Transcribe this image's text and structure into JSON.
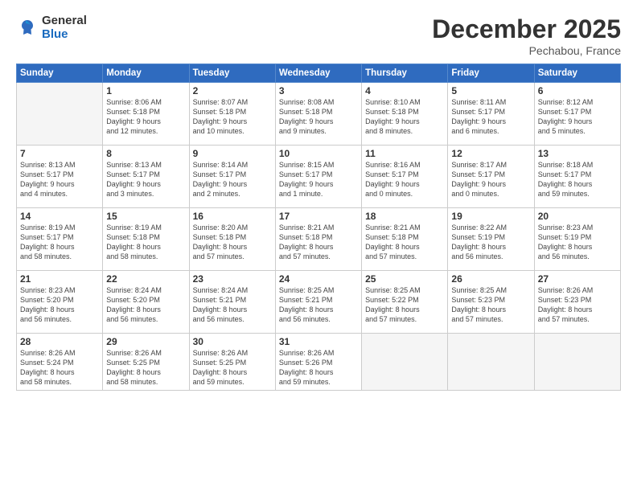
{
  "logo": {
    "general": "General",
    "blue": "Blue"
  },
  "title": "December 2025",
  "subtitle": "Pechabou, France",
  "headers": [
    "Sunday",
    "Monday",
    "Tuesday",
    "Wednesday",
    "Thursday",
    "Friday",
    "Saturday"
  ],
  "weeks": [
    [
      {
        "day": "",
        "empty": true,
        "info": ""
      },
      {
        "day": "1",
        "info": "Sunrise: 8:06 AM\nSunset: 5:18 PM\nDaylight: 9 hours\nand 12 minutes."
      },
      {
        "day": "2",
        "info": "Sunrise: 8:07 AM\nSunset: 5:18 PM\nDaylight: 9 hours\nand 10 minutes."
      },
      {
        "day": "3",
        "info": "Sunrise: 8:08 AM\nSunset: 5:18 PM\nDaylight: 9 hours\nand 9 minutes."
      },
      {
        "day": "4",
        "info": "Sunrise: 8:10 AM\nSunset: 5:18 PM\nDaylight: 9 hours\nand 8 minutes."
      },
      {
        "day": "5",
        "info": "Sunrise: 8:11 AM\nSunset: 5:17 PM\nDaylight: 9 hours\nand 6 minutes."
      },
      {
        "day": "6",
        "info": "Sunrise: 8:12 AM\nSunset: 5:17 PM\nDaylight: 9 hours\nand 5 minutes."
      }
    ],
    [
      {
        "day": "7",
        "info": "Sunrise: 8:13 AM\nSunset: 5:17 PM\nDaylight: 9 hours\nand 4 minutes."
      },
      {
        "day": "8",
        "info": "Sunrise: 8:13 AM\nSunset: 5:17 PM\nDaylight: 9 hours\nand 3 minutes."
      },
      {
        "day": "9",
        "info": "Sunrise: 8:14 AM\nSunset: 5:17 PM\nDaylight: 9 hours\nand 2 minutes."
      },
      {
        "day": "10",
        "info": "Sunrise: 8:15 AM\nSunset: 5:17 PM\nDaylight: 9 hours\nand 1 minute."
      },
      {
        "day": "11",
        "info": "Sunrise: 8:16 AM\nSunset: 5:17 PM\nDaylight: 9 hours\nand 0 minutes."
      },
      {
        "day": "12",
        "info": "Sunrise: 8:17 AM\nSunset: 5:17 PM\nDaylight: 9 hours\nand 0 minutes."
      },
      {
        "day": "13",
        "info": "Sunrise: 8:18 AM\nSunset: 5:17 PM\nDaylight: 8 hours\nand 59 minutes."
      }
    ],
    [
      {
        "day": "14",
        "info": "Sunrise: 8:19 AM\nSunset: 5:17 PM\nDaylight: 8 hours\nand 58 minutes."
      },
      {
        "day": "15",
        "info": "Sunrise: 8:19 AM\nSunset: 5:18 PM\nDaylight: 8 hours\nand 58 minutes."
      },
      {
        "day": "16",
        "info": "Sunrise: 8:20 AM\nSunset: 5:18 PM\nDaylight: 8 hours\nand 57 minutes."
      },
      {
        "day": "17",
        "info": "Sunrise: 8:21 AM\nSunset: 5:18 PM\nDaylight: 8 hours\nand 57 minutes."
      },
      {
        "day": "18",
        "info": "Sunrise: 8:21 AM\nSunset: 5:18 PM\nDaylight: 8 hours\nand 57 minutes."
      },
      {
        "day": "19",
        "info": "Sunrise: 8:22 AM\nSunset: 5:19 PM\nDaylight: 8 hours\nand 56 minutes."
      },
      {
        "day": "20",
        "info": "Sunrise: 8:23 AM\nSunset: 5:19 PM\nDaylight: 8 hours\nand 56 minutes."
      }
    ],
    [
      {
        "day": "21",
        "info": "Sunrise: 8:23 AM\nSunset: 5:20 PM\nDaylight: 8 hours\nand 56 minutes."
      },
      {
        "day": "22",
        "info": "Sunrise: 8:24 AM\nSunset: 5:20 PM\nDaylight: 8 hours\nand 56 minutes."
      },
      {
        "day": "23",
        "info": "Sunrise: 8:24 AM\nSunset: 5:21 PM\nDaylight: 8 hours\nand 56 minutes."
      },
      {
        "day": "24",
        "info": "Sunrise: 8:25 AM\nSunset: 5:21 PM\nDaylight: 8 hours\nand 56 minutes."
      },
      {
        "day": "25",
        "info": "Sunrise: 8:25 AM\nSunset: 5:22 PM\nDaylight: 8 hours\nand 57 minutes."
      },
      {
        "day": "26",
        "info": "Sunrise: 8:25 AM\nSunset: 5:23 PM\nDaylight: 8 hours\nand 57 minutes."
      },
      {
        "day": "27",
        "info": "Sunrise: 8:26 AM\nSunset: 5:23 PM\nDaylight: 8 hours\nand 57 minutes."
      }
    ],
    [
      {
        "day": "28",
        "info": "Sunrise: 8:26 AM\nSunset: 5:24 PM\nDaylight: 8 hours\nand 58 minutes."
      },
      {
        "day": "29",
        "info": "Sunrise: 8:26 AM\nSunset: 5:25 PM\nDaylight: 8 hours\nand 58 minutes."
      },
      {
        "day": "30",
        "info": "Sunrise: 8:26 AM\nSunset: 5:25 PM\nDaylight: 8 hours\nand 59 minutes."
      },
      {
        "day": "31",
        "info": "Sunrise: 8:26 AM\nSunset: 5:26 PM\nDaylight: 8 hours\nand 59 minutes."
      },
      {
        "day": "",
        "empty": true,
        "info": ""
      },
      {
        "day": "",
        "empty": true,
        "info": ""
      },
      {
        "day": "",
        "empty": true,
        "info": ""
      }
    ]
  ]
}
